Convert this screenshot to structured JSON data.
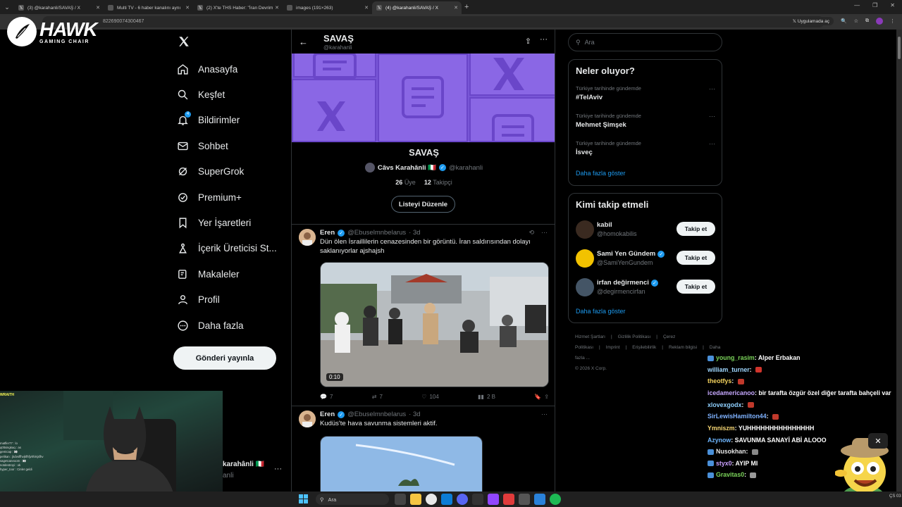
{
  "browser": {
    "tabs": [
      {
        "title": "(3) @karahanli/SAVAŞ / X",
        "icon": "x-icon",
        "active": false
      },
      {
        "title": "Multi TV - 6 haber kanalını aynı",
        "icon": "tv-icon",
        "active": false
      },
      {
        "title": "(2) X'te THS Haber: \"İran Devrim",
        "icon": "x-icon",
        "active": false
      },
      {
        "title": "images (191×263)",
        "icon": "image-icon",
        "active": false
      },
      {
        "title": "(4) @karahanli/SAVAŞ / X",
        "icon": "x-icon",
        "active": true
      }
    ],
    "url": "822690074300467",
    "open_in_app": "Uygulamada aç"
  },
  "overlay_logo": {
    "big": "HAWK",
    "small": "GAMING CHAIR"
  },
  "nav": {
    "items": [
      {
        "label": "Anasayfa",
        "icon": "home-icon"
      },
      {
        "label": "Keşfet",
        "icon": "search-icon"
      },
      {
        "label": "Bildirimler",
        "icon": "bell-icon",
        "badge": "4"
      },
      {
        "label": "Sohbet",
        "icon": "mail-icon"
      },
      {
        "label": "SuperGrok",
        "icon": "grok-icon"
      },
      {
        "label": "Premium+",
        "icon": "premium-icon"
      },
      {
        "label": "Yer İşaretleri",
        "icon": "bookmark-icon"
      },
      {
        "label": "İçerik Üreticisi St...",
        "icon": "creator-studio-icon"
      },
      {
        "label": "Makaleler",
        "icon": "articles-icon"
      },
      {
        "label": "Profil",
        "icon": "profile-icon"
      },
      {
        "label": "Daha fazla",
        "icon": "more-circle-icon"
      }
    ],
    "post_button": "Gönderi yayınla",
    "account_name": "karahânli 🇮🇹",
    "account_handle": "anli"
  },
  "list": {
    "title": "SAVAŞ",
    "handle": "@karahanli",
    "owner_name": "Câvs Karahânli 🇮🇹",
    "owner_handle": "@karahanli",
    "members_count": "26",
    "members_label": "Üye",
    "followers_count": "12",
    "followers_label": "Takipçi",
    "edit_button": "Listeyi Düzenle"
  },
  "posts": [
    {
      "name": "Eren",
      "handle": "@Ebuselmnbelarus",
      "time": "· 3d",
      "text": "Dün ölen İsraillilerin cenazesinden bir görüntü. İran saldırısından dolayı saklanıyorlar ajshajsh",
      "video_time": "0:10",
      "replies": "7",
      "reposts": "7",
      "likes": "104",
      "views": "2 B"
    },
    {
      "name": "Eren",
      "handle": "@Ebuselmnbelarus",
      "time": "· 3d",
      "text": "Kudüs'te hava savunma sistemleri aktif."
    }
  ],
  "right": {
    "search_placeholder": "Ara",
    "trends_title": "Neler oluyor?",
    "trends": [
      {
        "context": "Türkiye tarihinde gündemde",
        "name": "#TelAviv"
      },
      {
        "context": "Türkiye tarihinde gündemde",
        "name": "Mehmet Şimşek"
      },
      {
        "context": "Türkiye tarihinde gündemde",
        "name": "İsveç"
      }
    ],
    "show_more": "Daha fazla göster",
    "who_title": "Kimi takip etmeli",
    "who": [
      {
        "name": "kabil",
        "handle": "@homokabilis",
        "verified": false,
        "color": "#3a2a20"
      },
      {
        "name": "Sami Yen Gündem",
        "handle": "@SamiYenGundem",
        "verified": true,
        "color": "#f2c200"
      },
      {
        "name": "irfan değirmenci",
        "handle": "@degirmencirfan",
        "verified": true,
        "color": "#445566"
      }
    ],
    "follow_label": "Takip et",
    "footer": [
      "Hizmet Şartları",
      "|",
      "Gizlilik Politikası",
      "|",
      "Çerez Politikası",
      "|",
      "Imprint",
      "|",
      "Erişilebilirlik",
      "|",
      "Reklam bilgisi",
      "|",
      "Daha fazla ...",
      "© 2026 X Corp."
    ]
  },
  "stream_chat": [
    {
      "user": "young_rasim",
      "color": "#7bd45a",
      "text": ": Alper Erbakan",
      "badge": true
    },
    {
      "user": "william_turner",
      "color": "#9fd7ff",
      "text": ": ",
      "emoji": "#d0342c"
    },
    {
      "user": "theotfys",
      "color": "#f4d35e",
      "text": ": ",
      "emoji": "#c0392b"
    },
    {
      "user": "icedamericanoo",
      "color": "#c6a8ff",
      "text": ": bir tarafta özgür özel diğer tarafta bahçeli var",
      "wrap": true
    },
    {
      "user": "xlovexgodx",
      "color": "#8fd0ff",
      "text": ": ",
      "emoji": "#c0392b"
    },
    {
      "user": "SirLewisHamilton44",
      "color": "#7fb2ff",
      "text": ": ",
      "emoji": "#c0392b"
    },
    {
      "user": "Ymniszm",
      "color": "#f7d774",
      "text": ": YUHHHHHHHHHHHHHHH"
    },
    {
      "user": "Azynow",
      "color": "#6fb7ff",
      "text": ": SAVUNMA SANAYİ ABİ ALOOO"
    },
    {
      "user": "Nusokhan",
      "color": "#e8e8e8",
      "text": ": ",
      "emoji": "#888888",
      "badge": true
    },
    {
      "user": "styx0",
      "color": "#c9a0ff",
      "text": ": AYIP MI",
      "badge": true
    },
    {
      "user": "Gravitas0",
      "color": "#7bd45a",
      "text": ": ",
      "emoji": "#999999",
      "badge": true
    }
  ],
  "webcam": {
    "title": "WRAITH",
    "chat_lines": [
      "matfler77 : lo",
      "q0ltsingkaq : as",
      "gemicap : 👀",
      "pelikan : jkdvsffhvjkfhfjvhfvkjsfhv",
      "sagetcaneoom : 👀",
      "notdestroyi : ok",
      "hyper_toor : Cinler geldi"
    ]
  },
  "taskbar": {
    "search_placeholder": "Ara",
    "clock": "ÇS\n03"
  }
}
